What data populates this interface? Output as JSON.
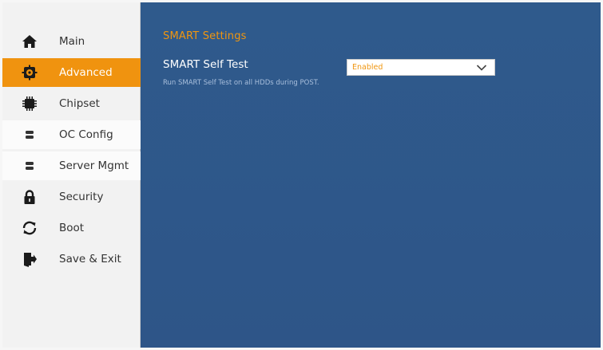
{
  "sidebar": {
    "items": [
      {
        "label": "Main",
        "icon": "home-icon"
      },
      {
        "label": "Advanced",
        "icon": "gear-icon",
        "active": true
      },
      {
        "label": "Chipset",
        "icon": "chip-icon"
      },
      {
        "label": "OC Config",
        "icon": "server-icon"
      },
      {
        "label": "Server Mgmt",
        "icon": "server-icon"
      },
      {
        "label": "Security",
        "icon": "lock-icon"
      },
      {
        "label": "Boot",
        "icon": "refresh-icon"
      },
      {
        "label": "Save & Exit",
        "icon": "exit-icon"
      }
    ]
  },
  "main": {
    "section_title": "SMART Settings",
    "setting": {
      "name": "SMART Self Test",
      "value": "Enabled",
      "description": "Run SMART Self Test on all HDDs during POST."
    }
  },
  "colors": {
    "accent": "#f0930f",
    "panel": "#2f5889",
    "sidebar": "#f2f2f2"
  }
}
